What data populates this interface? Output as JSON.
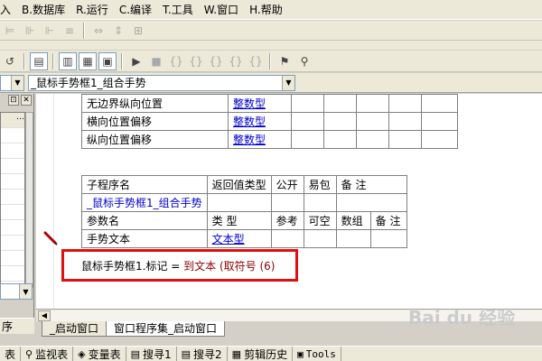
{
  "menu": [
    {
      "label": "入"
    },
    {
      "label": "B.数据库"
    },
    {
      "label": "R.运行"
    },
    {
      "label": "C.编译"
    },
    {
      "label": "T.工具"
    },
    {
      "label": "W.窗口"
    },
    {
      "label": "H.帮助"
    }
  ],
  "combo": {
    "selected": "_鼠标手势框1_组合手势"
  },
  "table1": {
    "rows": [
      {
        "name": "无边界纵向位置",
        "type": "整数型"
      },
      {
        "name": "横向位置偏移",
        "type": "整数型"
      },
      {
        "name": "纵向位置偏移",
        "type": "整数型"
      }
    ]
  },
  "table2": {
    "header": [
      "子程序名",
      "返回值类型",
      "公开",
      "易包",
      "备 注"
    ],
    "sub_name": "_鼠标手势框1_组合手势",
    "param_header": [
      "参数名",
      "类 型",
      "参考",
      "可空",
      "数组",
      "备 注"
    ],
    "param": {
      "name": "手势文本",
      "type": "文本型"
    }
  },
  "code": {
    "lhs": "鼠标手势框1.标记 =",
    "rhs": "到文本 (取符号 (6)"
  },
  "left_panel": {
    "bottom_label": "序"
  },
  "tabs": [
    {
      "label": "_启动窗口"
    },
    {
      "label": "窗口程序集_启动窗口"
    }
  ],
  "bottom_tabs": [
    {
      "label": "表"
    },
    {
      "label": "监视表"
    },
    {
      "label": "变量表"
    },
    {
      "label": "搜寻1"
    },
    {
      "label": "搜寻2"
    },
    {
      "label": "剪辑历史"
    },
    {
      "label": "Tools"
    }
  ],
  "watermark": "Bai du 经验"
}
